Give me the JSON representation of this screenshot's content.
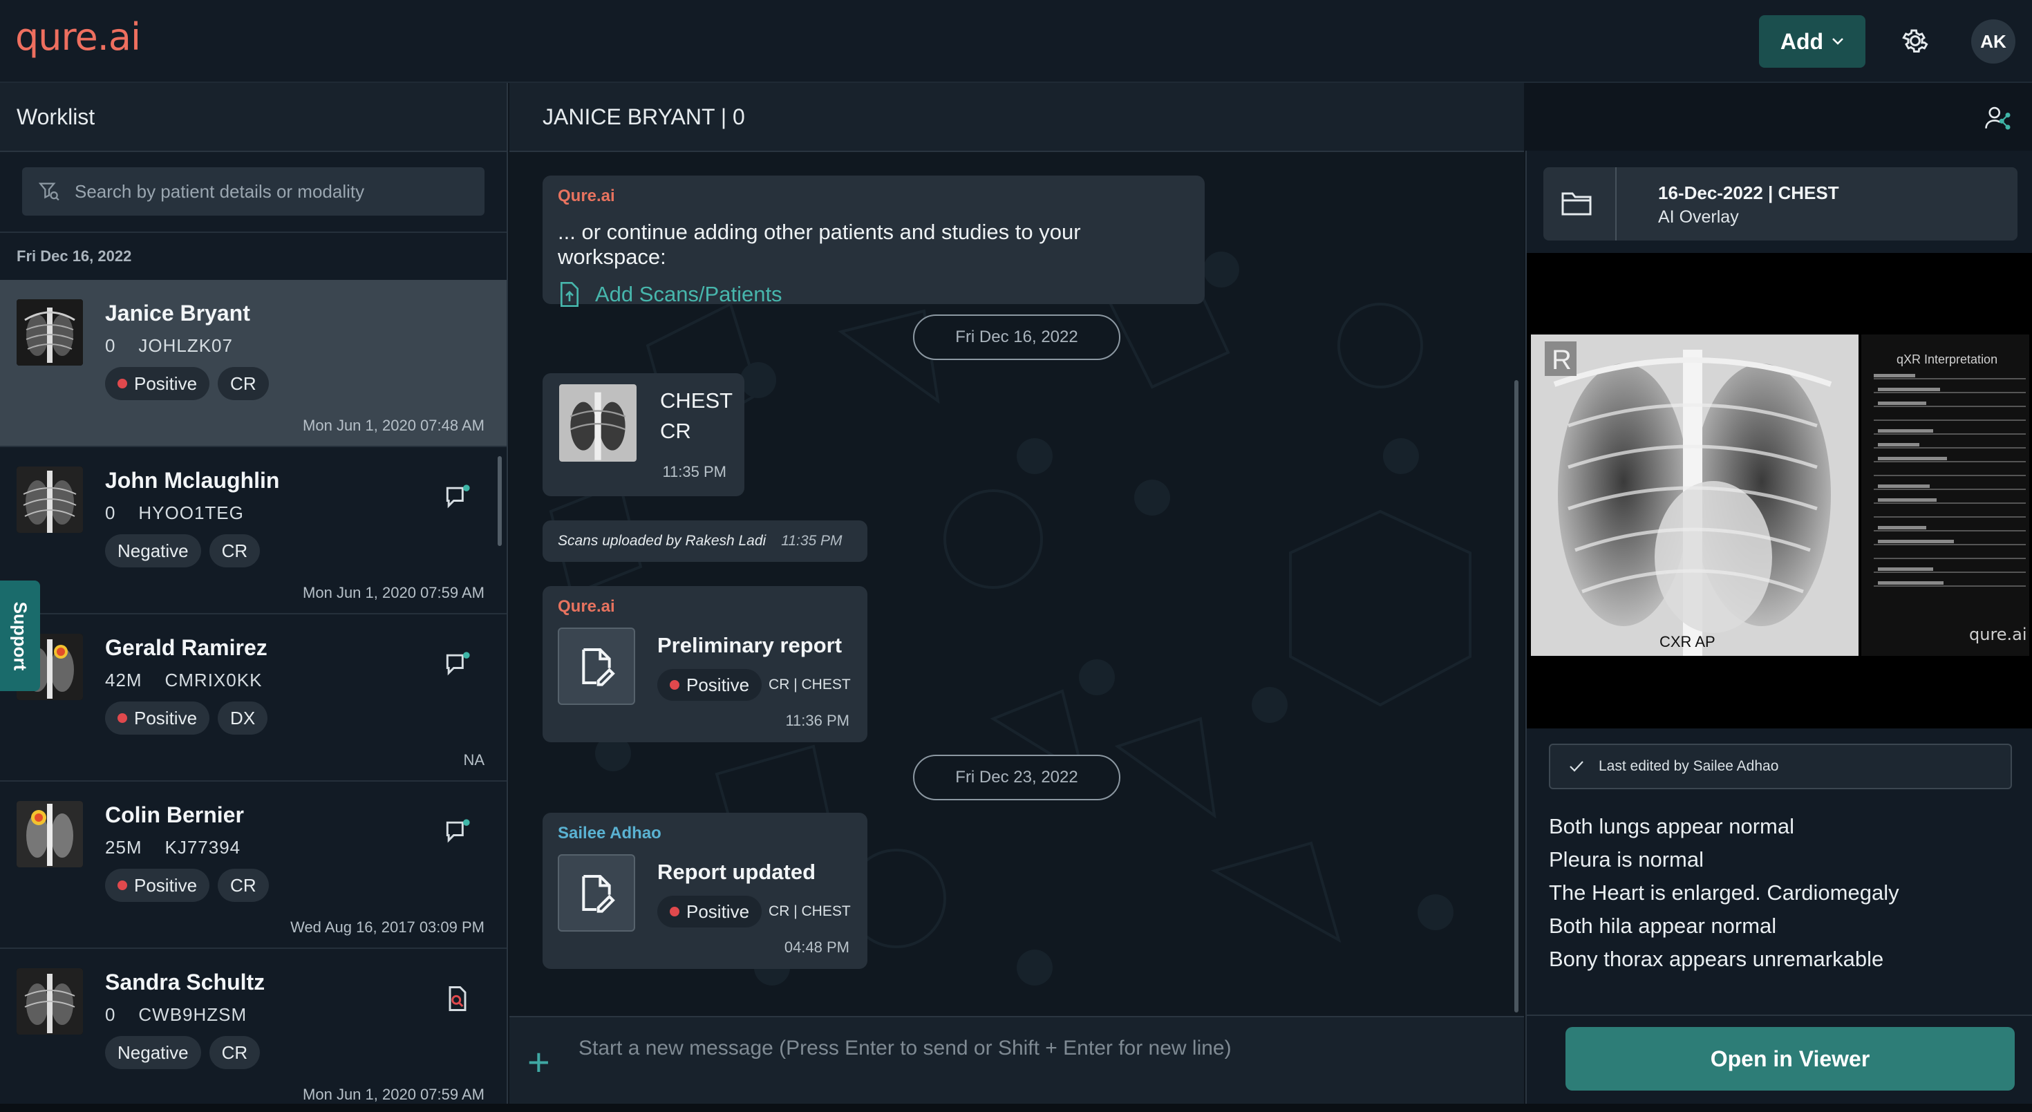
{
  "app": {
    "logo": "qure.ai",
    "add_label": "Add",
    "avatar_initials": "AK"
  },
  "worklist": {
    "title": "Worklist",
    "search_placeholder": "Search by patient details or modality",
    "date_group": "Fri Dec 16, 2022",
    "patients": [
      {
        "name": "Janice Bryant",
        "age": "0",
        "pid": "JOHLZK07",
        "status": "Positive",
        "modality": "CR",
        "time": "Mon Jun 1, 2020 07:48 AM",
        "selected": true,
        "icon": "none"
      },
      {
        "name": "John Mclaughlin",
        "age": "0",
        "pid": "HYOO1TEG",
        "status": "Negative",
        "modality": "CR",
        "time": "Mon Jun 1, 2020 07:59 AM",
        "icon": "chat-unread-icon"
      },
      {
        "name": "Gerald Ramirez",
        "age": "42M",
        "pid": "CMRIX0KK",
        "status": "Positive",
        "modality": "DX",
        "time": "NA",
        "icon": "chat-unread-icon"
      },
      {
        "name": "Colin Bernier",
        "age": "25M",
        "pid": "KJ77394",
        "status": "Positive",
        "modality": "CR",
        "time": "Wed Aug 16, 2017 03:09 PM",
        "icon": "chat-unread-icon"
      },
      {
        "name": "Sandra Schultz",
        "age": "0",
        "pid": "CWB9HZSM",
        "status": "Negative",
        "modality": "CR",
        "time": "Mon Jun 1, 2020 07:59 AM",
        "icon": "file-search-icon"
      }
    ],
    "support_label": "Support"
  },
  "chat": {
    "header": "JANICE BRYANT | 0",
    "msg1": {
      "sender": "Qure.ai",
      "text": "... or continue adding other patients and studies to your workspace:",
      "link": "Add Scans/Patients"
    },
    "date1": "Fri Dec 16, 2022",
    "scan": {
      "line1": "CHEST",
      "line2": "CR",
      "time": "11:35 PM"
    },
    "upload_note": {
      "text": "Scans uploaded by Rakesh Ladi",
      "time": "11:35 PM"
    },
    "report1": {
      "sender": "Qure.ai",
      "title": "Preliminary report",
      "status": "Positive",
      "meta": "CR | CHEST",
      "time": "11:36 PM"
    },
    "date2": "Fri Dec 23, 2022",
    "report2": {
      "sender": "Sailee Adhao",
      "title": "Report updated",
      "status": "Positive",
      "meta": "CR | CHEST",
      "time": "04:48 PM"
    },
    "composer_placeholder": "Start a new message (Press Enter to send or Shift + Enter for new line)"
  },
  "study": {
    "title": "16-Dec-2022 | CHEST",
    "subtitle": "AI Overlay",
    "xray_marker": "R",
    "xray_caption": "CXR AP",
    "interpretation_title": "qXR Interpretation",
    "watermark": "qure.ai",
    "last_edited": "Last edited by Sailee Adhao",
    "report_lines": [
      "Both lungs appear normal",
      "Pleura is normal",
      "The Heart is enlarged. Cardiomegaly",
      "Both hila appear normal",
      "Bony thorax appears unremarkable"
    ],
    "open_viewer_label": "Open in Viewer"
  },
  "colors": {
    "accent": "#2d7d77",
    "positive": "#e0494d",
    "brand": "#ee6f5f"
  }
}
